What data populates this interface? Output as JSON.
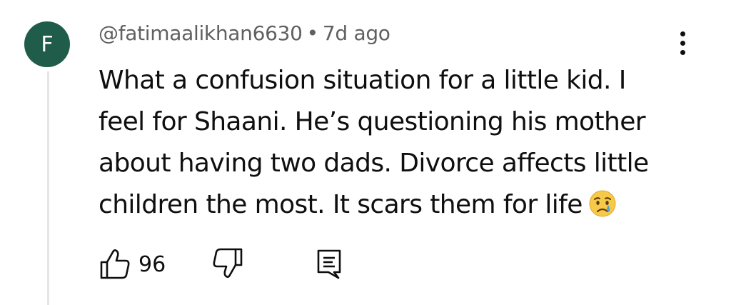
{
  "comment": {
    "author": "@fatimaalikhan6630",
    "separator": "•",
    "time_ago": "7d ago",
    "avatar_letter": "F",
    "avatar_color": "#1f5c49",
    "text": "What a confusion situation for a little kid. I feel for Shaani. He’s questioning his mother about having two dads. Divorce affects little children the most. It scars them for life",
    "emoji": "crying-face-emoji",
    "like_count": "96"
  },
  "icons": {
    "like": "thumbs-up-icon",
    "dislike": "thumbs-down-icon",
    "reply": "reply-comment-icon",
    "more": "more-vertical-icon"
  }
}
